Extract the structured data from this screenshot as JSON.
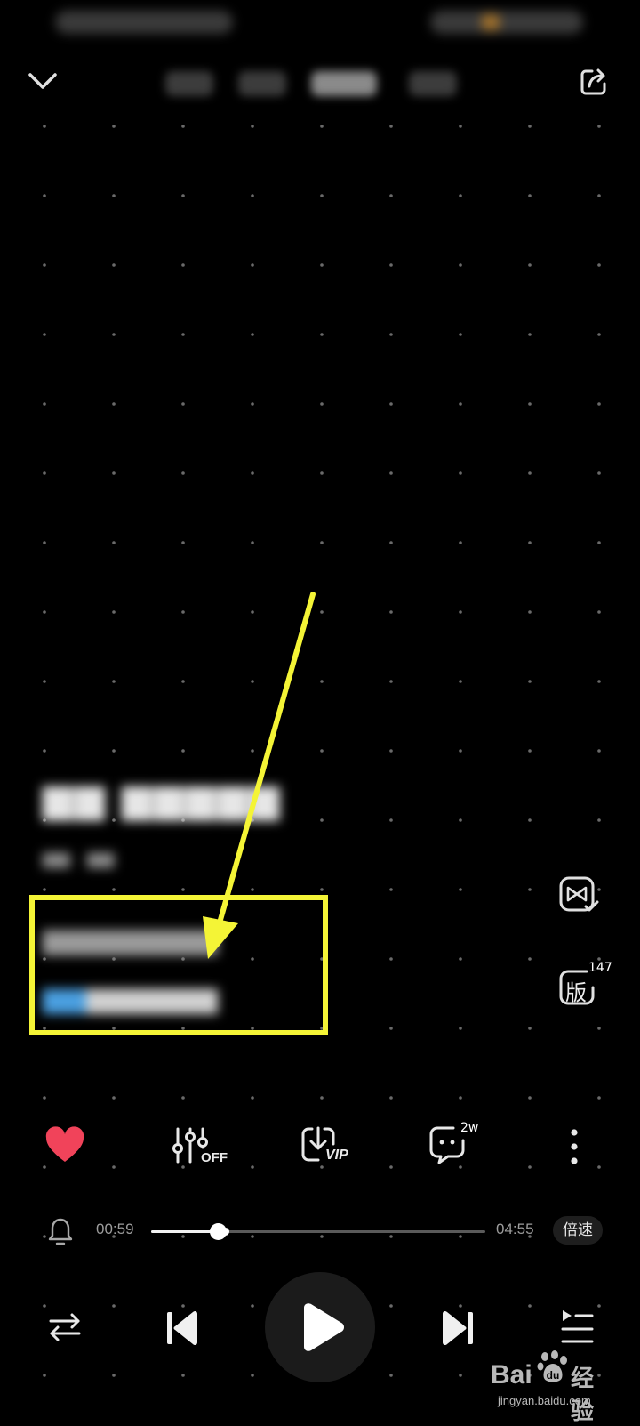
{
  "colors": {
    "background": "#000000",
    "highlight_box": "#f4f436",
    "arrow": "#f4f436",
    "heart": "#f1435a",
    "progress_fill": "#f2f2f2",
    "progress_track": "#5a5a5a",
    "lyric_highlight": "#4a9fe0"
  },
  "header": {
    "collapse_icon": "chevron-down-icon",
    "share_icon": "share-icon"
  },
  "side_actions": {
    "video_icon": "video-bowtie-icon",
    "version_label": "版",
    "version_count": "147"
  },
  "actions": {
    "like_icon": "heart-icon",
    "equalizer_icon": "equalizer-icon",
    "equalizer_state": "OFF",
    "download_icon": "download-icon",
    "download_tag": "VIP",
    "comment_icon": "comment-icon",
    "comment_count": "2w",
    "more_icon": "more-vertical-icon"
  },
  "player": {
    "alarm_icon": "bell-icon",
    "elapsed": "00:59",
    "duration": "04:55",
    "progress_fraction": 0.2,
    "buffered_fraction": 0.22,
    "speed_label": "倍速",
    "repeat_icon": "repeat-icon",
    "prev_icon": "skip-previous-icon",
    "play_icon": "play-icon",
    "next_icon": "skip-next-icon",
    "playlist_icon": "playlist-icon"
  },
  "watermark": {
    "brand_left": "Bai",
    "brand_right": "经验",
    "url": "jingyan.baidu.com"
  }
}
